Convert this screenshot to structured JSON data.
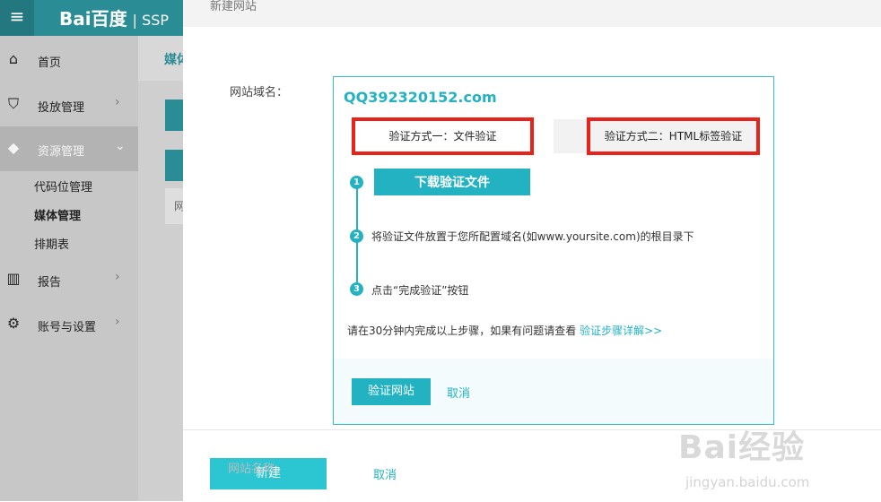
{
  "header": {
    "logo": "Bai百度",
    "product": "SSP"
  },
  "sidebar": {
    "items": [
      {
        "label": "首页",
        "icon": "home-icon"
      },
      {
        "label": "投放管理",
        "icon": "shield-icon"
      },
      {
        "label": "资源管理",
        "icon": "cube-icon"
      },
      {
        "label": "报告",
        "icon": "bar-chart-icon"
      },
      {
        "label": "账号与设置",
        "icon": "gear-icon"
      }
    ],
    "sub_items": [
      "代码位管理",
      "媒体管理",
      "排期表"
    ],
    "current_sub": "媒体管理"
  },
  "page": {
    "breadcrumb": "媒体",
    "behind_text": "网"
  },
  "modal": {
    "title": "新建网站",
    "field_label": "网站域名：",
    "domain": "QQ392320152.com",
    "tab1": "验证方式一：文件验证",
    "tab2": "验证方式二：HTML标签验证",
    "download_btn": "下载验证文件",
    "steps": [
      {
        "num": "1"
      },
      {
        "num": "2",
        "text": "将验证文件放置于您所配置域名(如www.yoursite.com)的根目录下"
      },
      {
        "num": "3",
        "text": "点击“完成验证”按钮"
      }
    ],
    "note": "请在30分钟内完成以上步骤，如果有问题请查看",
    "note_link": "验证步骤详解>>",
    "verify_btn": "验证网站",
    "cancel": "取消",
    "footer_ghost_label": "网站名称",
    "create_btn": "新建",
    "footer_cancel": "取消"
  },
  "watermark": {
    "main": "Bai经验",
    "sub": "jingyan.baidu.com"
  },
  "colors": {
    "teal": "#2a8c95",
    "accent": "#22b2c2",
    "highlight_red": "#e8231c"
  }
}
